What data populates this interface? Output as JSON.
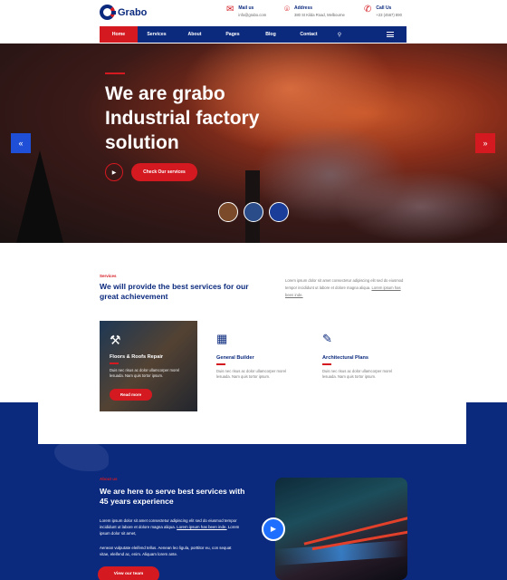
{
  "brand": {
    "name": "Grabo"
  },
  "contacts": [
    {
      "icon": "mail-icon",
      "title": "Mail us",
      "value": "info@grabo.com"
    },
    {
      "icon": "location-pin-icon",
      "title": "Address",
      "value": "380 St Kilda Road, Melbourne"
    },
    {
      "icon": "phone-icon",
      "title": "Call Us",
      "value": "+23 (4567) 890"
    }
  ],
  "nav": {
    "items": [
      "Home",
      "Services",
      "About",
      "Pages",
      "Blog",
      "Contact"
    ],
    "active": "Home",
    "search_icon": "search-icon",
    "menu_icon": "hamburger-menu-icon"
  },
  "hero": {
    "title_line1": "We are grabo",
    "title_line2": "Industrial factory",
    "title_line3": "solution",
    "cta_label": "Check Our services",
    "prev_icon": "double-chevron-left-icon",
    "next_icon": "double-chevron-right-icon"
  },
  "services": {
    "label": "Services",
    "title": "We will provide the best services for our great achievement",
    "desc_plain": "Lorem ipsum dolor sit amet consectetur adipiscing elit sed do eiusmod tempor incididunt ut labore et dolore magna aliqua.",
    "desc_link": "Lorem ipsum has been inde.",
    "items": [
      {
        "icon": "tools-icon",
        "title": "Floors & Roofs Repair",
        "desc": "Duis nec risus ac dolor ullamcorper morel lesuada. Nam quis tortor ipsum.",
        "button": "Read more"
      },
      {
        "icon": "brick-wall-icon",
        "title": "General Builder",
        "desc": "Duis nec risus ac dolor ullamcorper morel lesuada. Nam quis tortor ipsum."
      },
      {
        "icon": "ruler-pencil-icon",
        "title": "Architectural Plans",
        "desc": "Duis nec risus ac dolor ullamcorper morel lesuada. Nam quis tortor ipsum."
      }
    ]
  },
  "about": {
    "label": "About us",
    "title": "We are here to serve best services with 45 years experience",
    "p1_plain": "Lorem ipsum dolor sit amet consectetur adipiscing elit sed do eiusmod tempor incididunt ut labore et dolore magna aliqua.",
    "p1_link": "Lorem ipsum has been inde.",
    "p1_tail": "Lorem ipsum dolor sit amet,",
    "p2": "Aenean vulputate eleifend tellus. Aenean leo ligula, porttitor eu, con sequat vitae, eleifend ac, enim. Aliquam lorem ante.",
    "button": "View our team"
  },
  "colors": {
    "primary": "#0b2a7e",
    "accent": "#d41920",
    "highlight": "#1e4fd6"
  }
}
